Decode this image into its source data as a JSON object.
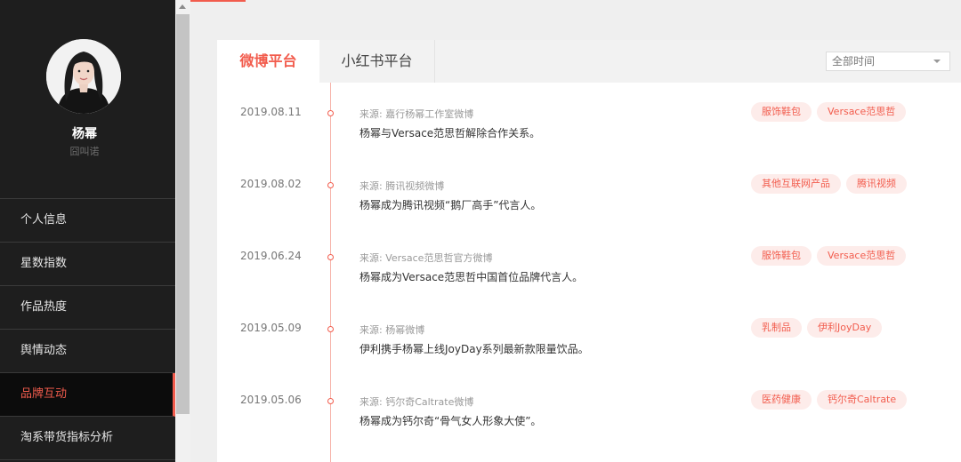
{
  "user": {
    "name": "杨幂",
    "subtitle": "囧叫诺",
    "avatar_icon": "female-portrait-photo"
  },
  "menu": [
    {
      "label": "个人信息",
      "active": false
    },
    {
      "label": "星数指数",
      "active": false
    },
    {
      "label": "作品热度",
      "active": false
    },
    {
      "label": "舆情动态",
      "active": false
    },
    {
      "label": "品牌互动",
      "active": true
    },
    {
      "label": "淘系带货指标分析",
      "active": false
    }
  ],
  "tabs": {
    "weibo": "微博平台",
    "xiaohongshu": "小红书平台",
    "active": "weibo"
  },
  "time_filter": {
    "selected": "全部时间"
  },
  "events": [
    {
      "date": "2019.08.11",
      "source": "来源:  嘉行杨幂工作室微博",
      "text": "杨幂与Versace范思哲解除合作关系。",
      "tags": [
        "服饰鞋包",
        "Versace范思哲"
      ]
    },
    {
      "date": "2019.08.02",
      "source": "来源:  腾讯视频微博",
      "text": "杨幂成为腾讯视频“鹅厂高手”代言人。",
      "tags": [
        "其他互联网产品",
        "腾讯视频"
      ]
    },
    {
      "date": "2019.06.24",
      "source": "来源:  Versace范思哲官方微博",
      "text": "杨幂成为Versace范思哲中国首位品牌代言人。",
      "tags": [
        "服饰鞋包",
        "Versace范思哲"
      ]
    },
    {
      "date": "2019.05.09",
      "source": "来源:  杨幂微博",
      "text": "伊利携手杨幂上线JoyDay系列最新款限量饮品。",
      "tags": [
        "乳制品",
        "伊利JoyDay"
      ]
    },
    {
      "date": "2019.05.06",
      "source": "来源:  钙尔奇Caltrate微博",
      "text": "杨幂成为钙尔奇“骨气女人形象大使”。",
      "tags": [
        "医药健康",
        "钙尔奇Caltrate"
      ]
    }
  ],
  "colors": {
    "accent": "#f25c4d",
    "tag_bg": "#fdecea",
    "sidebar_bg": "#1e1e1e"
  }
}
